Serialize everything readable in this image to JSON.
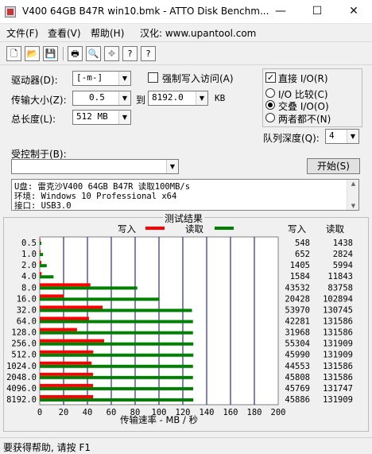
{
  "window": {
    "title": "V400 64GB B47R win10.bmk - ATTO Disk Benchm...",
    "min_glyph": "—",
    "max_glyph": "☐",
    "close_glyph": "✕"
  },
  "menu": {
    "file": "文件(F)",
    "view": "查看(V)",
    "help": "帮助(H)",
    "credit": "汉化: www.upantool.com"
  },
  "toolbar": {
    "new": "🗋",
    "open": "📂",
    "save": "💾",
    "print": "🖶",
    "preview": "🔍",
    "move": "✥",
    "help": "?",
    "context_help": "?"
  },
  "settings": {
    "drive_label": "驱动器(D):",
    "drive_value": "[-m-]",
    "force_write_label": "强制写入访问(A)",
    "force_write_checked": false,
    "direct_io_label": "直接 I/O(R)",
    "direct_io_checked": true,
    "direct_io_mark": "✓",
    "transfer_label": "传输大小(Z):",
    "transfer_from": "0.5",
    "to_label": "到",
    "transfer_to": "8192.0",
    "unit": "KB",
    "total_label": "总长度(L):",
    "total_value": "512 MB",
    "io_options": [
      "I/O 比较(C)",
      "交叠 I/O(O)",
      "两者都不(N)"
    ],
    "io_selected": 1,
    "queue_label": "队列深度(Q):",
    "queue_value": "4",
    "controlled_label": "受控制于(B):",
    "controlled_value": "",
    "start_button": "开始(S)",
    "dropdown_glyph": "▼"
  },
  "info_lines": [
    "U盘: 雷克沙V400 64GB B47R 读取100MB/s",
    "环境: Windows 10 Professional x64",
    "接口: USB3.0"
  ],
  "scroll": {
    "up": "▲",
    "down": "▼"
  },
  "results_title": "测试结果",
  "chart_data": {
    "type": "bar",
    "orientation": "horizontal",
    "categories": [
      "0.5",
      "1.0",
      "2.0",
      "4.0",
      "8.0",
      "16.0",
      "32.0",
      "64.0",
      "128.0",
      "256.0",
      "512.0",
      "1024.0",
      "2048.0",
      "4096.0",
      "8192.0"
    ],
    "series": [
      {
        "name": "写入",
        "color": "#ff0000",
        "values_kbps": [
          548,
          652,
          1405,
          1584,
          43532,
          20428,
          53970,
          42281,
          31968,
          55304,
          45990,
          44553,
          45808,
          45769,
          45886
        ]
      },
      {
        "name": "读取",
        "color": "#008000",
        "values_kbps": [
          1438,
          2824,
          5994,
          11843,
          83758,
          102894,
          130745,
          131586,
          131586,
          131909,
          131909,
          131586,
          131586,
          131747,
          131909
        ]
      }
    ],
    "xlim": [
      0,
      200
    ],
    "xticks": [
      "0",
      "20",
      "40",
      "60",
      "80",
      "100",
      "120",
      "140",
      "160",
      "180",
      "200"
    ],
    "xlabel": "传输速率 - MB / 秒",
    "col_write_header": "写入",
    "col_read_header": "读取",
    "legend": "top"
  },
  "status": "要获得帮助, 请按 F1"
}
